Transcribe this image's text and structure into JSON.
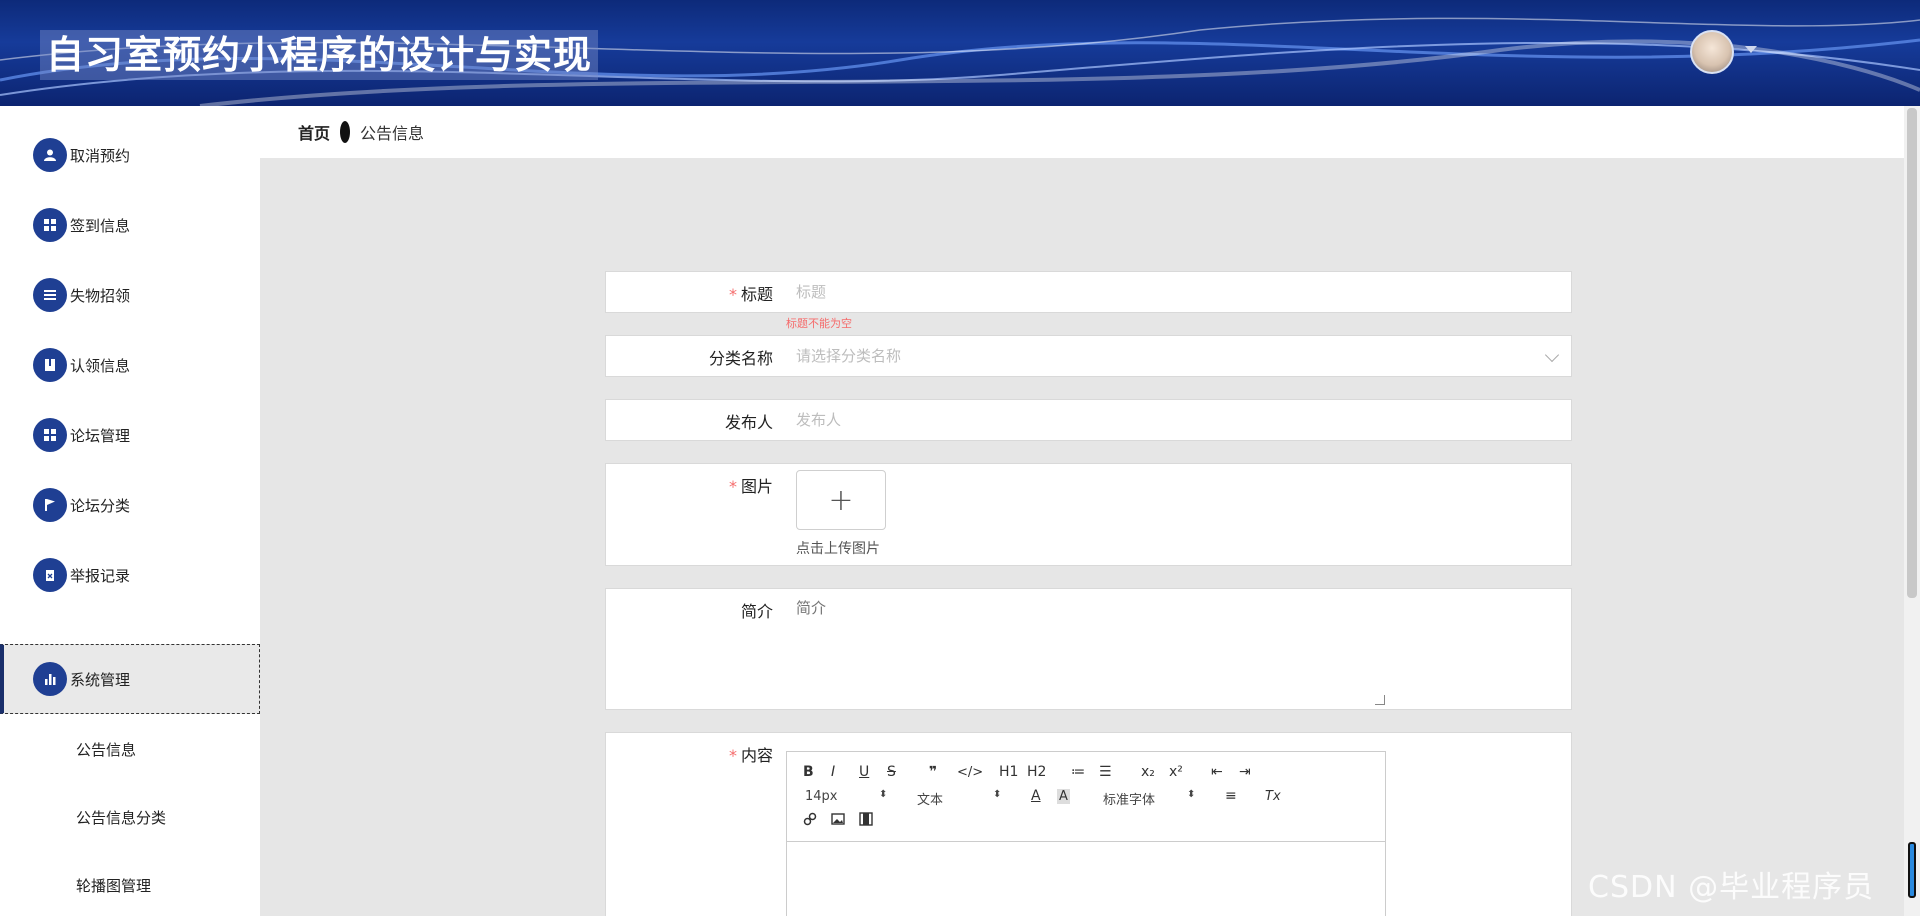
{
  "header": {
    "title": "自习室预约小程序的设计与实现",
    "avatar_icon": "user-avatar"
  },
  "breadcrumb": {
    "home": "首页",
    "current": "公告信息"
  },
  "sidebar": {
    "items": [
      {
        "label": "取消预约",
        "icon": "person-icon"
      },
      {
        "label": "签到信息",
        "icon": "grid-icon"
      },
      {
        "label": "失物招领",
        "icon": "list-icon"
      },
      {
        "label": "认领信息",
        "icon": "book-icon"
      },
      {
        "label": "论坛管理",
        "icon": "grid-icon"
      },
      {
        "label": "论坛分类",
        "icon": "flag-icon"
      },
      {
        "label": "举报记录",
        "icon": "clipboard-icon"
      },
      {
        "label": "系统管理",
        "icon": "bar-chart-icon",
        "active": true
      }
    ],
    "submenu": [
      {
        "label": "公告信息"
      },
      {
        "label": "公告信息分类"
      },
      {
        "label": "轮播图管理"
      }
    ]
  },
  "form": {
    "title": {
      "label": "标题",
      "required": true,
      "placeholder": "标题",
      "error": "标题不能为空"
    },
    "category": {
      "label": "分类名称",
      "placeholder": "请选择分类名称"
    },
    "publisher": {
      "label": "发布人",
      "placeholder": "发布人"
    },
    "image": {
      "label": "图片",
      "required": true,
      "upload_hint": "点击上传图片",
      "upload_symbol": "+"
    },
    "summary": {
      "label": "简介",
      "placeholder": "简介"
    },
    "content": {
      "label": "内容",
      "required": true
    }
  },
  "editor_toolbar": {
    "row1": [
      "B",
      "I",
      "U",
      "S",
      "❞",
      "</>",
      "H1",
      "H2",
      "≔",
      "☰",
      "x₂",
      "x²",
      "⇤",
      "⇥"
    ],
    "font_size": "14px",
    "text_type": "文本",
    "font_family": "标准字体",
    "row2_icons": [
      "A",
      "A",
      "≡",
      "Tx"
    ],
    "row3_icons": [
      "link",
      "image",
      "video"
    ]
  },
  "watermark": "CSDN @毕业程序员",
  "colors": {
    "header_bg": "#12308a",
    "menu_icon_bg": "#1f3f93",
    "required": "#f56c6c",
    "content_bg": "#e6e6e6"
  }
}
